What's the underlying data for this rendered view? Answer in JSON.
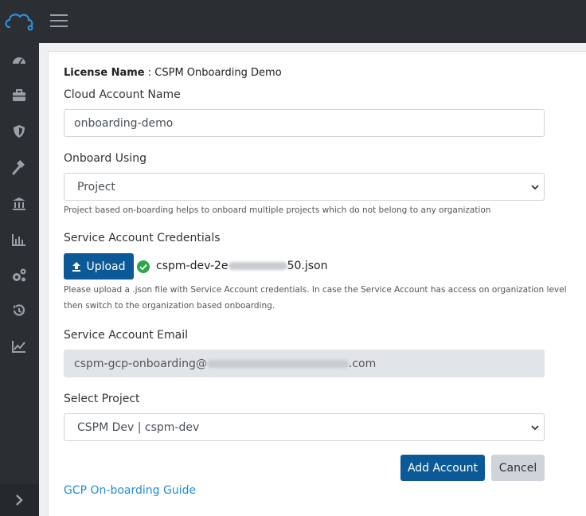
{
  "topbar": {
    "logo_icon": "cloud-gear-icon",
    "menu_icon": "hamburger-icon"
  },
  "sidebar": {
    "items": [
      {
        "icon": "dashboard-gauge-icon"
      },
      {
        "icon": "briefcase-icon"
      },
      {
        "icon": "shield-icon"
      },
      {
        "icon": "gavel-icon"
      },
      {
        "icon": "bank-icon"
      },
      {
        "icon": "bar-chart-icon"
      },
      {
        "icon": "gears-icon"
      },
      {
        "icon": "history-icon"
      },
      {
        "icon": "line-chart-icon"
      }
    ],
    "footer_icon": "chevron-right-icon"
  },
  "form": {
    "license_label": "License Name",
    "license_value": " : CSPM Onboarding Demo",
    "cloud_account_name_label": "Cloud Account Name",
    "cloud_account_name_value": "onboarding-demo",
    "onboard_using_label": "Onboard Using",
    "onboard_using_value": "Project",
    "onboard_using_help": "Project based on-boarding helps to onboard multiple projects which do not belong to any organization",
    "credentials_label": "Service Account Credentials",
    "upload_label": "Upload",
    "uploaded_file_prefix": "cspm-dev-2e",
    "uploaded_file_suffix": "50.json",
    "credentials_help_line1": "Please upload a .json file with Service Account credentials. In case the Service Account has access on organization level",
    "credentials_help_line2": "then switch to the organization based onboarding.",
    "sa_email_label": "Service Account Email",
    "sa_email_prefix": "cspm-gcp-onboarding@",
    "sa_email_suffix": ".com",
    "select_project_label": "Select Project",
    "select_project_value": "CSPM Dev | cspm-dev",
    "add_account_label": "Add Account",
    "cancel_label": "Cancel",
    "guide_link": "GCP On-boarding Guide"
  },
  "colors": {
    "primary": "#0b5a97",
    "link": "#1f8dd6",
    "success": "#28a745",
    "sidebar": "#2b2e33"
  }
}
